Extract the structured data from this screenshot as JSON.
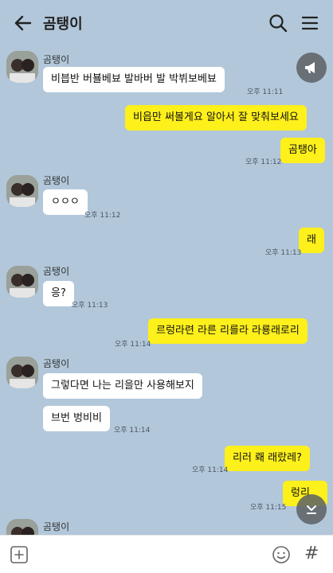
{
  "header": {
    "title": "곰탱이",
    "back_icon": "arrow-left-icon",
    "search_icon": "search-icon",
    "menu_icon": "hamburger-menu-icon"
  },
  "sender_name": "곰탱이",
  "messages": [
    {
      "dir": "in",
      "text": "비븝반 버뵬베뵤 발바버 발 박뷔보베뵤",
      "time": "오후 11:11"
    },
    {
      "dir": "out",
      "text": "비읍만 써볼게요 알아서 잘 맞춰보세요",
      "time": ""
    },
    {
      "dir": "out",
      "text": "곰탱아",
      "time": "오후 11:12"
    },
    {
      "dir": "in",
      "text": "ㅇㅇㅇ",
      "time": "오후 11:12"
    },
    {
      "dir": "out",
      "text": "래",
      "time": "오후 11:13"
    },
    {
      "dir": "in",
      "text": "응?",
      "time": "오후 11:13"
    },
    {
      "dir": "out",
      "text": "르렁라련 라른 리를라 라룡래로리",
      "time": "오후 11:14"
    },
    {
      "dir": "in",
      "text": "그렇다면 나는 리을만 사용해보지",
      "time": ""
    },
    {
      "dir": "in",
      "text": "브번 벙비비",
      "time": "오후 11:14"
    },
    {
      "dir": "out",
      "text": "리러 뢔 래랐레?",
      "time": "오후 11:14"
    },
    {
      "dir": "out",
      "text": "렁리",
      "time": "오후 11:15"
    }
  ],
  "colors": {
    "background": "#b2c7da",
    "outgoing_bubble": "#fef01b",
    "incoming_bubble": "#ffffff"
  }
}
